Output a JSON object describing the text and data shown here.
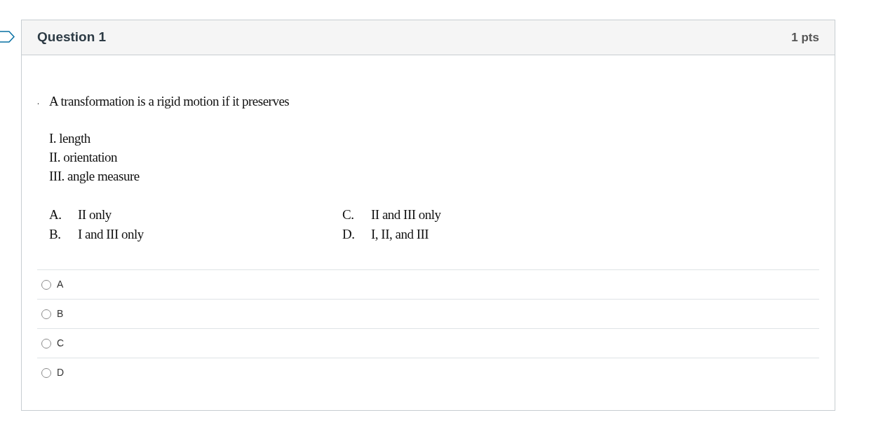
{
  "question": {
    "title": "Question 1",
    "points": "1 pts",
    "flagged": false
  },
  "body": {
    "marker": ".",
    "stem": "A transformation is a rigid motion if it preserves",
    "statements": [
      "I. length",
      "II. orientation",
      "III. angle measure"
    ],
    "choices_left": [
      {
        "letter": "A.",
        "text": "II only"
      },
      {
        "letter": "B.",
        "text": "I and III only"
      }
    ],
    "choices_right": [
      {
        "letter": "C.",
        "text": "II and III only"
      },
      {
        "letter": "D.",
        "text": "I, II, and III"
      }
    ]
  },
  "answers": [
    {
      "label": "A",
      "selected": false
    },
    {
      "label": "B",
      "selected": false
    },
    {
      "label": "C",
      "selected": false
    },
    {
      "label": "D",
      "selected": false
    }
  ]
}
